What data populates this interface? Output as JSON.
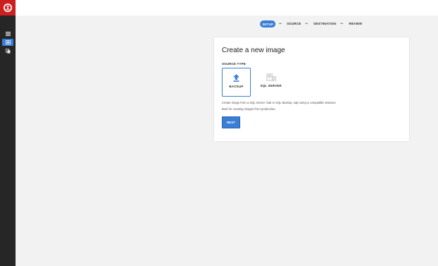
{
  "app": {
    "brand_color": "#cc1f1f",
    "accent_color": "#3a7fd5"
  },
  "sidebar": {
    "items": [
      {
        "icon": "list-icon",
        "active": false
      },
      {
        "icon": "image-icon",
        "active": true
      },
      {
        "icon": "copy-icon",
        "active": false
      }
    ]
  },
  "stepper": {
    "steps": [
      "SETUP",
      "SOURCE",
      "DESTINATION",
      "REVIEW"
    ],
    "separator": "••",
    "current": "SETUP"
  },
  "card": {
    "title": "Create a new image",
    "source_type_label": "SOURCE TYPE",
    "options": [
      {
        "label": "BACKUP",
        "icon": "upload-icon",
        "selected": true
      },
      {
        "label": "SQL SERVER",
        "icon": "sql-server-icon",
        "selected": false
      }
    ],
    "description_line1": "Create image from a SQL Server .bak or SQL Backup .sqb using a compatible instance",
    "description_line2": "Best for creating images from production.",
    "next_label": "NEXT"
  }
}
